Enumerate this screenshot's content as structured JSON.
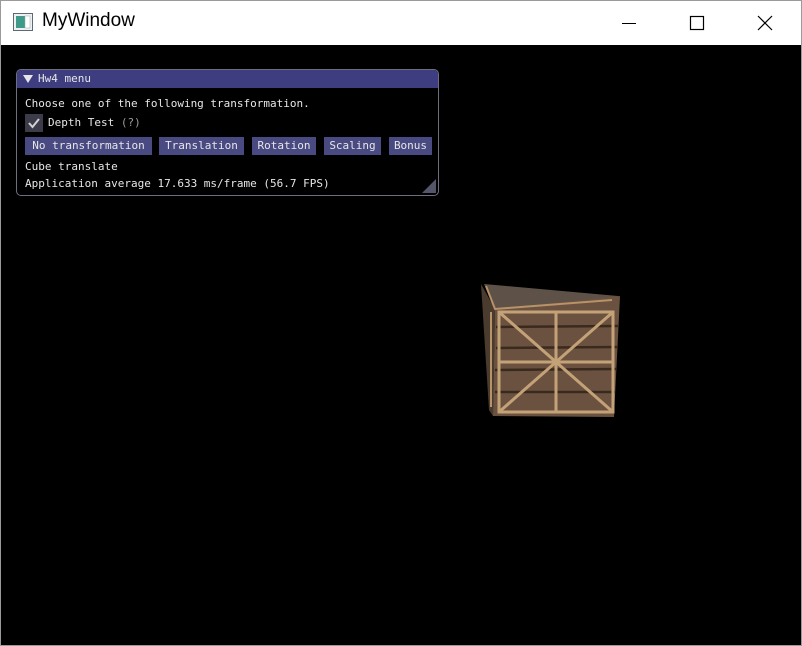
{
  "window": {
    "title": "MyWindow"
  },
  "menu": {
    "title": "Hw4 menu",
    "instruction": "Choose one of the following transformation.",
    "depth_test": {
      "label": "Depth Test",
      "help": "(?)",
      "checked": true
    },
    "buttons": [
      "No transformation",
      "Translation",
      "Rotation",
      "Scaling",
      "Bonus"
    ],
    "status": "Cube translate",
    "fps_text": "Application average 17.633 ms/frame (56.7 FPS)"
  },
  "colors": {
    "menu_title_bar": "#3d3d80",
    "button": "#4a4a82",
    "viewport_background": "#000000",
    "crate_wood": "#6b5240"
  }
}
